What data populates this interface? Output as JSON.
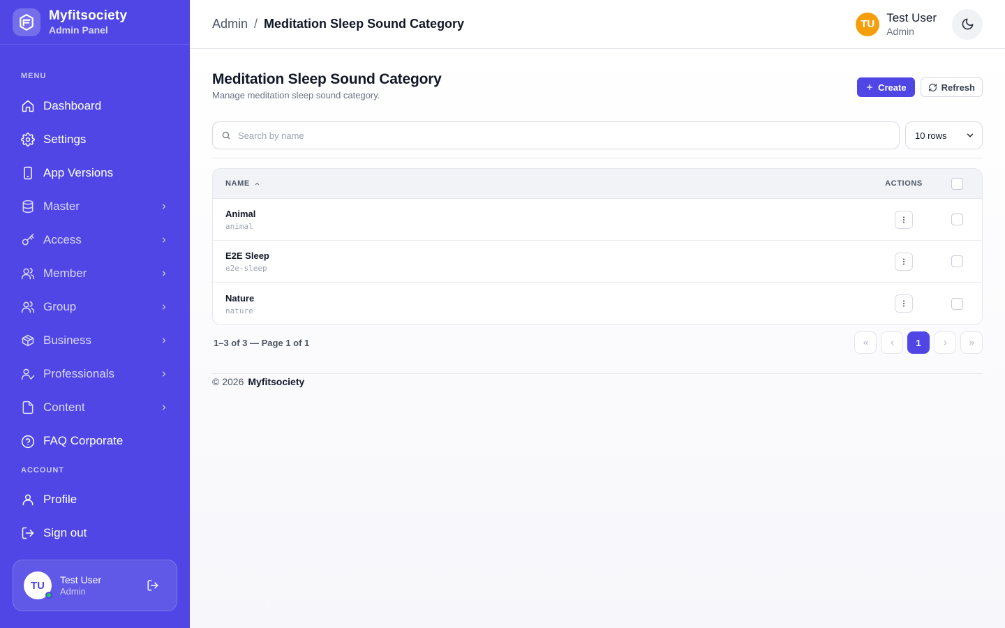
{
  "brand": {
    "name": "Myfitsociety",
    "subtitle": "Admin Panel"
  },
  "sidebar": {
    "menu_label": "MENU",
    "items": [
      {
        "label": "Dashboard",
        "icon": "home-icon",
        "has_children": false
      },
      {
        "label": "Settings",
        "icon": "gear-icon",
        "has_children": false
      },
      {
        "label": "App Versions",
        "icon": "smartphone-icon",
        "has_children": false
      },
      {
        "label": "Master",
        "icon": "database-icon",
        "has_children": true
      },
      {
        "label": "Access",
        "icon": "key-icon",
        "has_children": true
      },
      {
        "label": "Member",
        "icon": "users-icon",
        "has_children": true
      },
      {
        "label": "Group",
        "icon": "users-icon",
        "has_children": true
      },
      {
        "label": "Business",
        "icon": "box-icon",
        "has_children": true
      },
      {
        "label": "Professionals",
        "icon": "user-check-icon",
        "has_children": true
      },
      {
        "label": "Content",
        "icon": "file-icon",
        "has_children": true
      },
      {
        "label": "FAQ Corporate",
        "icon": "help-circle-icon",
        "has_children": false
      }
    ],
    "account_label": "ACCOUNT",
    "account_items": [
      {
        "label": "Profile",
        "icon": "user-icon"
      },
      {
        "label": "Sign out",
        "icon": "log-out-icon"
      }
    ],
    "user_card": {
      "initials": "TU",
      "name": "Test User",
      "role": "Admin",
      "status": "online"
    }
  },
  "header": {
    "breadcrumb": {
      "root": "Admin",
      "separator": "/",
      "current": "Meditation Sleep Sound Category"
    },
    "user": {
      "initials": "TU",
      "name": "Test User",
      "role": "Admin"
    },
    "theme_toggle": "moon-icon"
  },
  "page": {
    "title": "Meditation Sleep Sound Category",
    "subtitle": "Manage meditation sleep sound category.",
    "create_label": "Create",
    "refresh_label": "Refresh"
  },
  "search": {
    "placeholder": "Search by name",
    "value": ""
  },
  "rows_select": {
    "value": "10 rows"
  },
  "table": {
    "columns": {
      "name": "NAME",
      "actions": "ACTIONS"
    },
    "sort": {
      "column": "name",
      "direction": "asc"
    },
    "rows": [
      {
        "name": "Animal",
        "slug": "animal"
      },
      {
        "name": "E2E Sleep",
        "slug": "e2e-sleep"
      },
      {
        "name": "Nature",
        "slug": "nature"
      }
    ]
  },
  "pagination": {
    "info": "1–3 of 3 — Page 1 of 1",
    "current_page": "1"
  },
  "footer": {
    "copyright": "© 2026",
    "brand": "Myfitsociety"
  },
  "colors": {
    "sidebar": "#4f46e5",
    "accent": "#4f46e5",
    "avatar_header": "#f59e0b",
    "online": "#22c55e"
  }
}
